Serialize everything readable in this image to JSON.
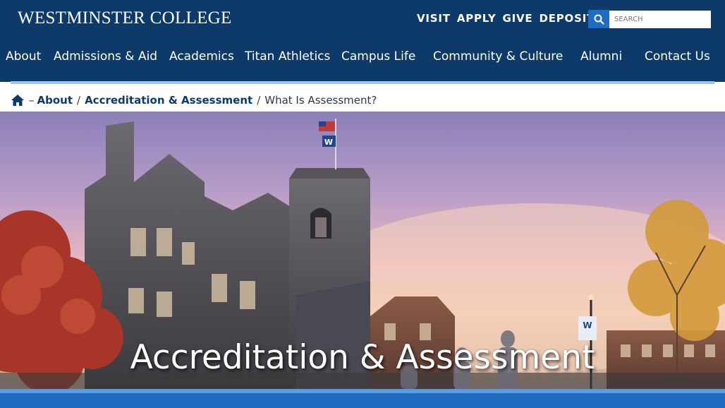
{
  "site": {
    "logo": "WESTMINSTER COLLEGE"
  },
  "utility_nav": [
    "VISIT",
    "APPLY",
    "GIVE",
    "DEPOSIT"
  ],
  "search": {
    "placeholder": "SEARCH",
    "icon": "search-icon"
  },
  "main_nav": [
    "About",
    "Admissions & Aid",
    "Academics",
    "Titan Athletics",
    "Campus Life",
    "Community & Culture",
    "Alumni",
    "Contact Us"
  ],
  "breadcrumb": {
    "home_icon": "home-icon",
    "home_separator": "–",
    "separator": "/",
    "items": [
      "About",
      "Accreditation & Assessment"
    ],
    "current": "What Is Assessment?"
  },
  "hero": {
    "title": "Accreditation & Assessment",
    "image": "campus-building-at-sunset",
    "flag_letter": "W",
    "banner_letter": "W"
  },
  "colors": {
    "navy": "#0d3a69",
    "light_blue_rule": "#9cc4ec",
    "accent_blue": "#1f6cc4"
  }
}
